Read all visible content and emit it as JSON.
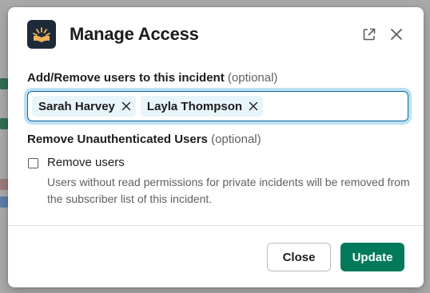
{
  "modal": {
    "title": "Manage Access",
    "logo_icon": "open-book-icon",
    "popout_icon": "external-link-icon",
    "close_icon": "close-icon"
  },
  "users_field": {
    "label": "Add/Remove users to this incident",
    "optional_hint": "(optional)",
    "selected_users": [
      "Sarah Harvey",
      "Layla Thompson"
    ]
  },
  "unauth_section": {
    "label": "Remove Unauthenticated Users",
    "optional_hint": "(optional)",
    "checkbox_label": "Remove users",
    "checkbox_checked": false,
    "help_text": "Users without read permissions for private incidents will be removed from the subscriber list of this incident."
  },
  "footer": {
    "close_label": "Close",
    "update_label": "Update"
  },
  "colors": {
    "primary": "#007a5a",
    "focus_ring": "#1264a3",
    "chip_bg": "#e8f5fa"
  }
}
